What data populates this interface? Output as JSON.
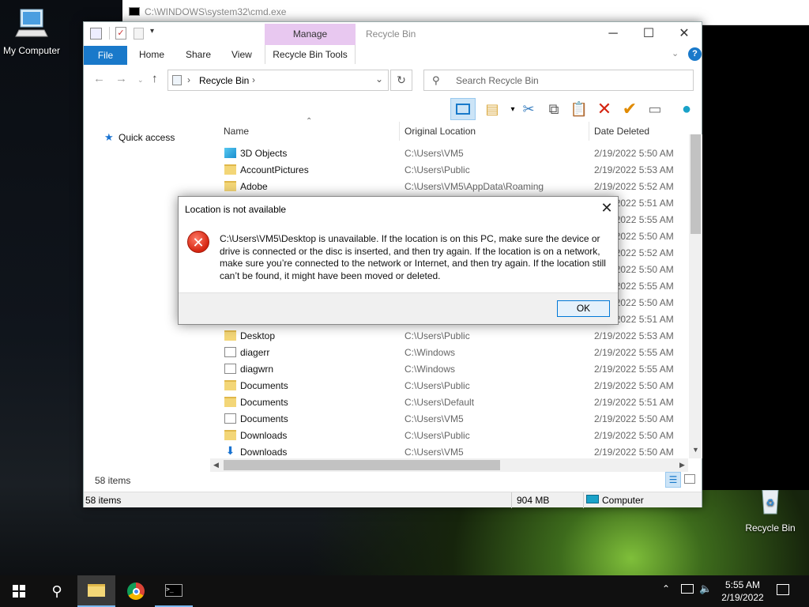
{
  "desktop": {
    "my_computer_label": "My Computer",
    "recycle_bin_label": "Recycle Bin"
  },
  "cmd_window": {
    "title": "C:\\WINDOWS\\system32\\cmd.exe"
  },
  "explorer": {
    "title": "Recycle Bin",
    "ribbon": {
      "file": "File",
      "home": "Home",
      "share": "Share",
      "view": "View",
      "manage": "Manage",
      "tools": "Recycle Bin Tools"
    },
    "address": {
      "location": "Recycle Bin"
    },
    "search": {
      "placeholder": "Search Recycle Bin"
    },
    "nav": {
      "quick_access": "Quick access"
    },
    "columns": {
      "name": "Name",
      "original_location": "Original Location",
      "date_deleted": "Date Deleted"
    },
    "rows": [
      {
        "name": "3D Objects",
        "location": "C:\\Users\\VM5",
        "date": "2/19/2022 5:50 AM",
        "icon": "cube"
      },
      {
        "name": "AccountPictures",
        "location": "C:\\Users\\Public",
        "date": "2/19/2022 5:53 AM",
        "icon": "folder"
      },
      {
        "name": "Adobe",
        "location": "C:\\Users\\VM5\\AppData\\Roaming",
        "date": "2/19/2022 5:52 AM",
        "icon": "folder"
      }
    ],
    "hidden_dates": [
      "2/19/2022 5:51 AM",
      "2/19/2022 5:55 AM",
      "2/19/2022 5:50 AM",
      "2/19/2022 5:52 AM",
      "2/19/2022 5:50 AM",
      "2/19/2022 5:55 AM",
      "2/19/2022 5:50 AM",
      "2/19/2022 5:51 AM"
    ],
    "rows_below": [
      {
        "name": "Desktop",
        "location": "C:\\Users\\Public",
        "date": "2/19/2022 5:53 AM",
        "icon": "folder"
      },
      {
        "name": "diagerr",
        "location": "C:\\Windows",
        "date": "2/19/2022 5:55 AM",
        "icon": "doc"
      },
      {
        "name": "diagwrn",
        "location": "C:\\Windows",
        "date": "2/19/2022 5:55 AM",
        "icon": "doc"
      },
      {
        "name": "Documents",
        "location": "C:\\Users\\Public",
        "date": "2/19/2022 5:50 AM",
        "icon": "folder"
      },
      {
        "name": "Documents",
        "location": "C:\\Users\\Default",
        "date": "2/19/2022 5:51 AM",
        "icon": "folder"
      },
      {
        "name": "Documents",
        "location": "C:\\Users\\VM5",
        "date": "2/19/2022 5:50 AM",
        "icon": "doc"
      },
      {
        "name": "Downloads",
        "location": "C:\\Users\\Public",
        "date": "2/19/2022 5:50 AM",
        "icon": "folder"
      },
      {
        "name": "Downloads",
        "location": "C:\\Users\\VM5",
        "date": "2/19/2022 5:50 AM",
        "icon": "download"
      }
    ],
    "item_count_inner": "58 items",
    "status": {
      "items": "58 items",
      "size": "904 MB",
      "computer": "Computer"
    }
  },
  "dialog": {
    "title": "Location is not available",
    "message": "C:\\Users\\VM5\\Desktop is unavailable. If the location is on this PC, make sure the device or drive is connected or the disc is inserted, and then try again. If the location is on a network, make sure you’re connected to the network or Internet, and then try again. If the location still can’t be found, it might have been moved or deleted.",
    "ok": "OK"
  },
  "taskbar": {
    "time": "5:55 AM",
    "date": "2/19/2022"
  },
  "colors": {
    "accent": "#1979ca",
    "manage_tab": "#e8c8f0",
    "error": "#d42410",
    "ok_border": "#0078d7"
  }
}
